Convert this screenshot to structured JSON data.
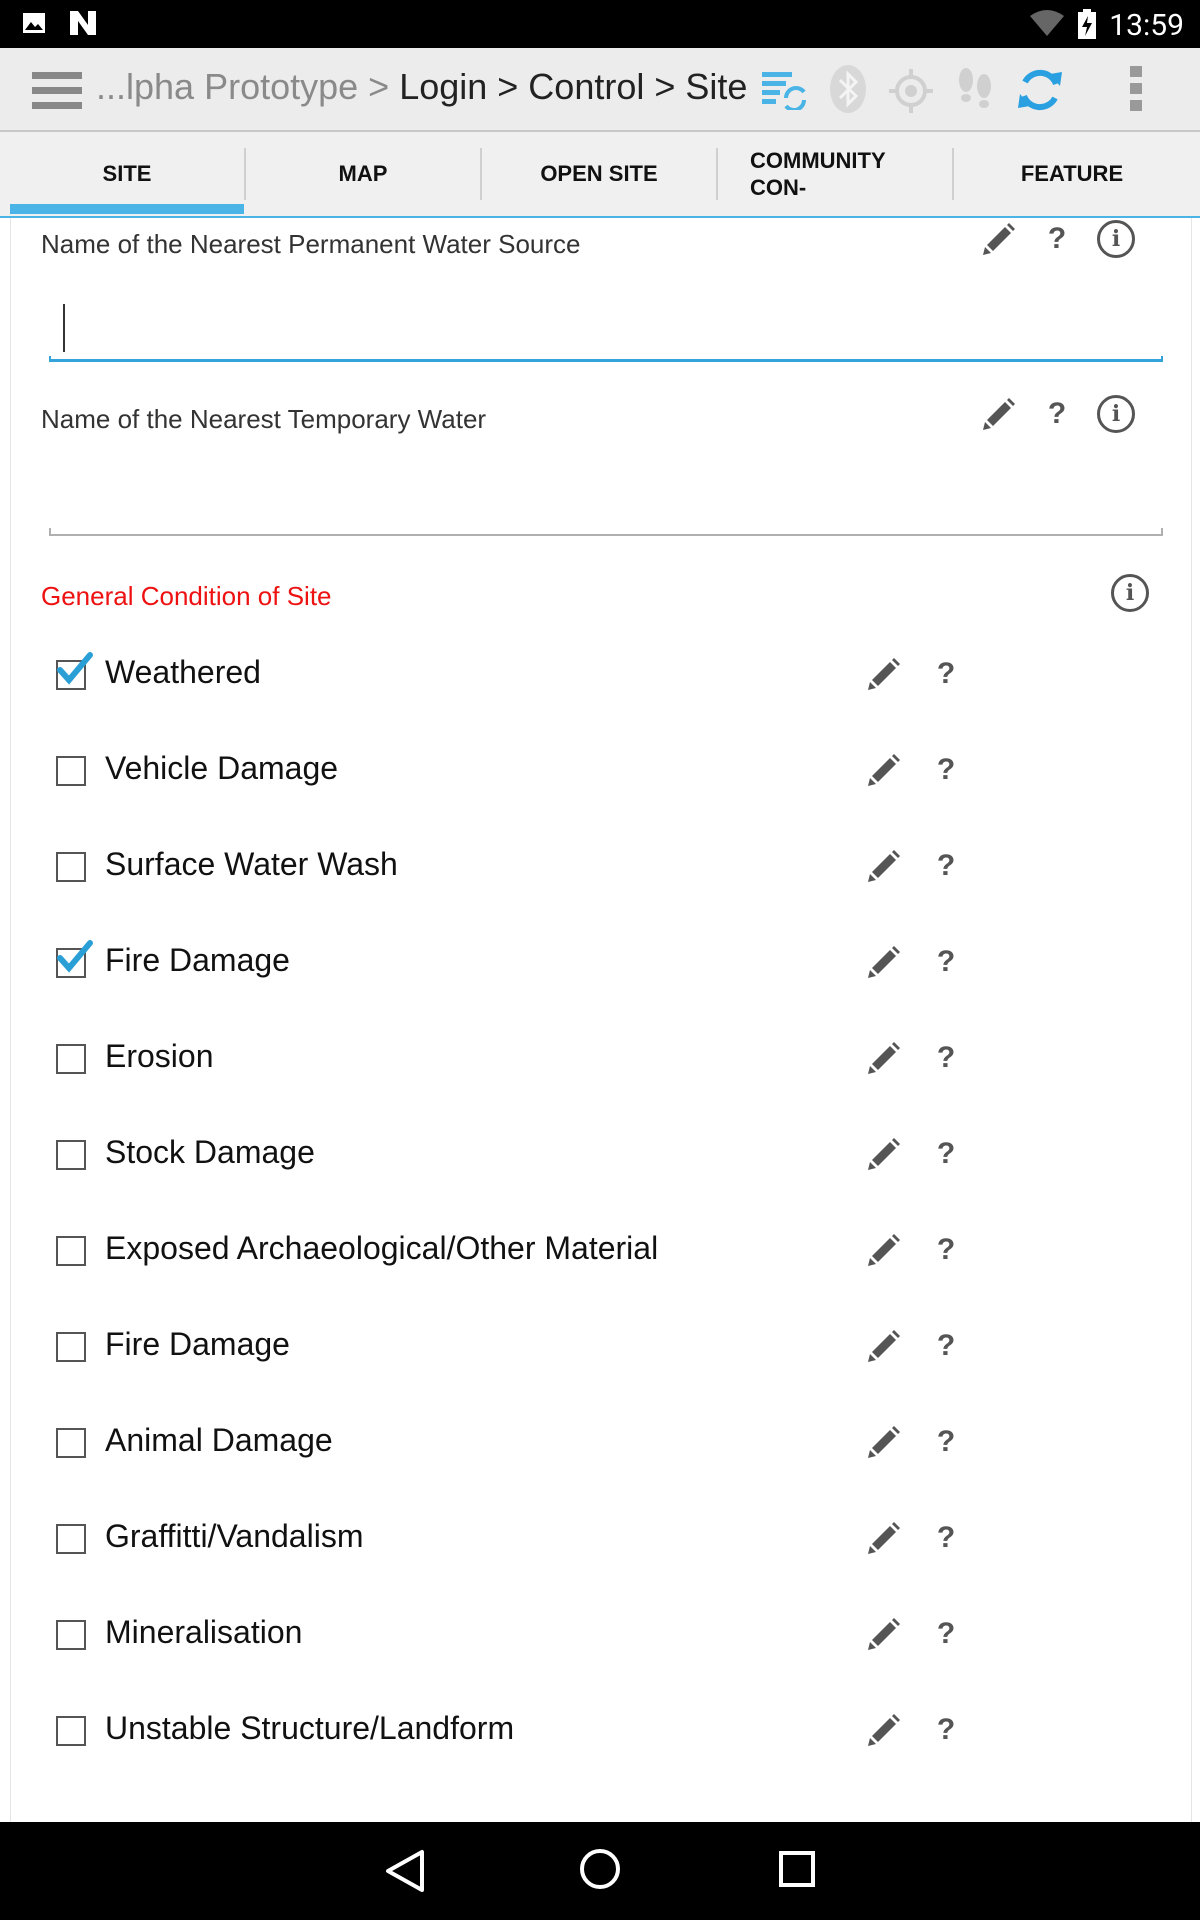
{
  "status_bar": {
    "time": "13:59",
    "icons": [
      "image-icon",
      "n-logo-icon",
      "wifi-icon",
      "battery-charging-icon"
    ]
  },
  "action_bar": {
    "menu_icon": "hamburger-menu-icon",
    "breadcrumb_dim": "...lpha Prototype >",
    "breadcrumb_rest": " Login > Control > Site",
    "action_icons": [
      "sync-list-icon",
      "bluetooth-icon",
      "gps-icon",
      "footsteps-icon",
      "refresh-icon",
      "overflow-menu-icon"
    ]
  },
  "tabs": [
    {
      "label": "SITE",
      "active": true
    },
    {
      "label": "MAP",
      "active": false
    },
    {
      "label": "OPEN SITE",
      "active": false
    },
    {
      "label": "COMMUNITY CON-",
      "active": false
    },
    {
      "label": "FEATURE",
      "active": false
    }
  ],
  "fields": {
    "permanent_water": {
      "label": "Name of the Nearest Permanent Water Source",
      "value": ""
    },
    "temporary_water": {
      "label": "Name of the Nearest Temporary Water",
      "value": ""
    }
  },
  "condition": {
    "title": "General Condition of Site",
    "items": [
      {
        "label": "Weathered",
        "checked": true
      },
      {
        "label": "Vehicle Damage",
        "checked": false
      },
      {
        "label": "Surface Water Wash",
        "checked": false
      },
      {
        "label": "Fire Damage",
        "checked": true
      },
      {
        "label": "Erosion",
        "checked": false
      },
      {
        "label": "Stock Damage",
        "checked": false
      },
      {
        "label": "Exposed Archaeological/Other Material",
        "checked": false
      },
      {
        "label": "Fire Damage",
        "checked": false
      },
      {
        "label": "Animal Damage",
        "checked": false
      },
      {
        "label": "Graffitti/Vandalism",
        "checked": false
      },
      {
        "label": "Mineralisation",
        "checked": false
      },
      {
        "label": "Unstable Structure/Landform",
        "checked": false
      }
    ]
  },
  "help_mark": "?",
  "colors": {
    "accent": "#4ab4e6",
    "section_title": "#ee1111",
    "check": "#2a9fd6"
  },
  "nav_bar": {
    "icons": [
      "back-icon",
      "home-icon",
      "recents-icon"
    ]
  }
}
